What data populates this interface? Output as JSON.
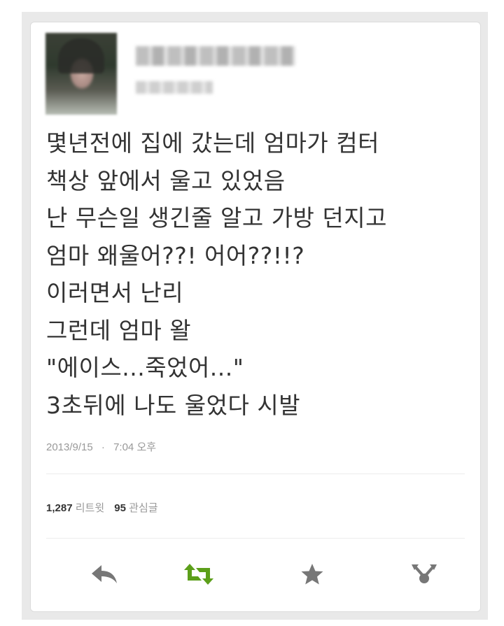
{
  "tweet": {
    "lines": [
      "몇년전에 집에 갔는데 엄마가 컴터",
      "책상 앞에서 울고 있었음",
      "난 무슨일 생긴줄 알고 가방 던지고",
      "엄마 왜울어??! 어어??!!?",
      "이러면서 난리",
      "그런데 엄마 왈",
      "\"에이스...죽었어...\"",
      "3초뒤에 나도 울었다 시발"
    ],
    "timestamp_date": "2013/9/15",
    "separator": "·",
    "timestamp_time": "7:04 오후"
  },
  "stats": {
    "retweets_count": "1,287",
    "retweets_label": "리트윗",
    "favorites_count": "95",
    "favorites_label": "관심글"
  },
  "actions": [
    {
      "name": "reply",
      "icon": "reply-icon",
      "color": "#777777"
    },
    {
      "name": "retweet",
      "icon": "retweet-icon",
      "color": "#5c9f1a"
    },
    {
      "name": "favorite",
      "icon": "star-icon",
      "color": "#777777"
    },
    {
      "name": "more",
      "icon": "share-icon",
      "color": "#777777"
    }
  ]
}
